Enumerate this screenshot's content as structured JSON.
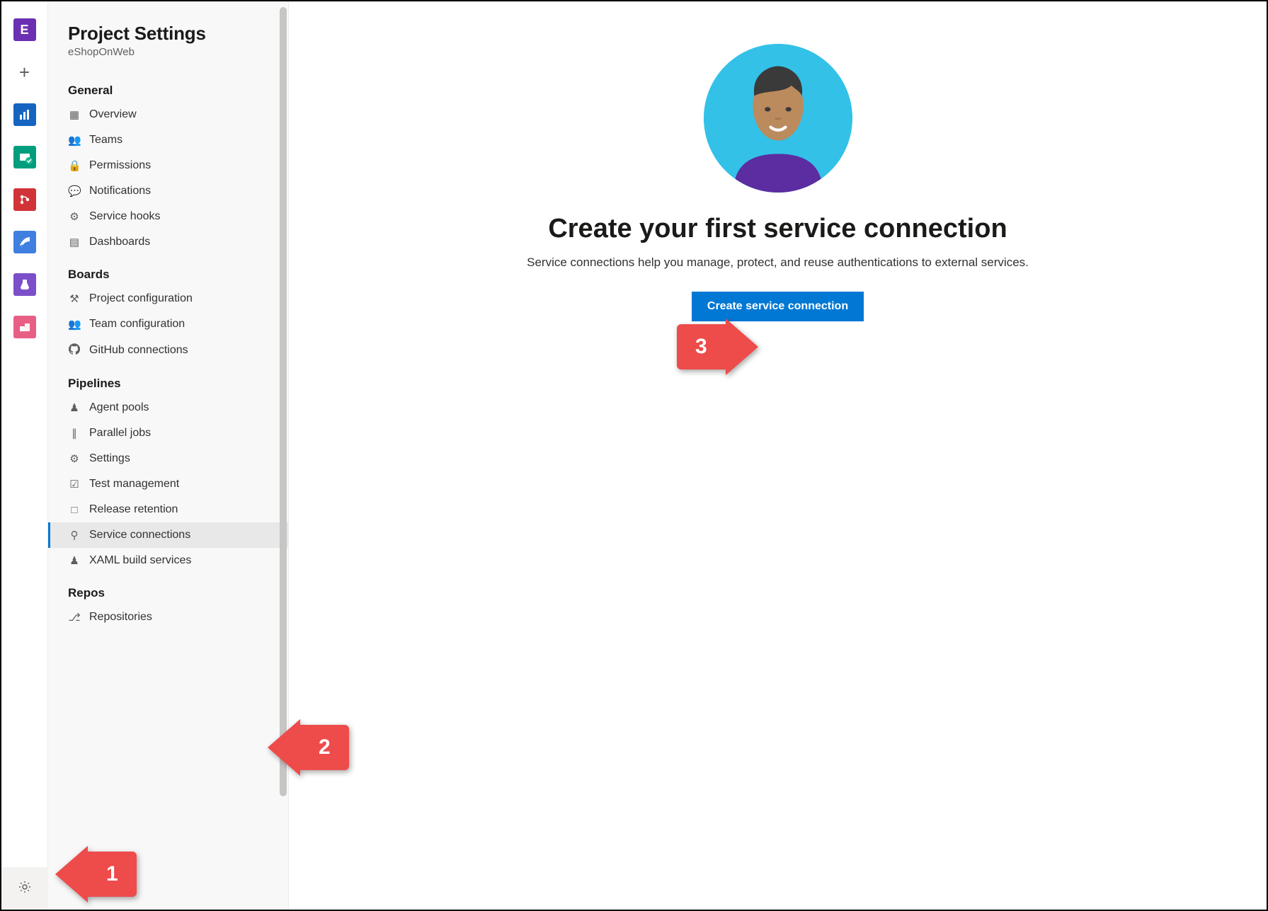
{
  "rail": {
    "project_initial": "E",
    "add_label": "+"
  },
  "settings": {
    "title": "Project Settings",
    "subtitle": "eShopOnWeb",
    "sections": [
      {
        "label": "General",
        "items": [
          {
            "icon": "overview",
            "label": "Overview"
          },
          {
            "icon": "teams",
            "label": "Teams"
          },
          {
            "icon": "permissions",
            "label": "Permissions"
          },
          {
            "icon": "notifications",
            "label": "Notifications"
          },
          {
            "icon": "service-hooks",
            "label": "Service hooks"
          },
          {
            "icon": "dashboards",
            "label": "Dashboards"
          }
        ]
      },
      {
        "label": "Boards",
        "items": [
          {
            "icon": "project-config",
            "label": "Project configuration"
          },
          {
            "icon": "team-config",
            "label": "Team configuration"
          },
          {
            "icon": "github",
            "label": "GitHub connections"
          }
        ]
      },
      {
        "label": "Pipelines",
        "items": [
          {
            "icon": "agent-pools",
            "label": "Agent pools"
          },
          {
            "icon": "parallel-jobs",
            "label": "Parallel jobs"
          },
          {
            "icon": "settings",
            "label": "Settings"
          },
          {
            "icon": "test-mgmt",
            "label": "Test management"
          },
          {
            "icon": "release-retention",
            "label": "Release retention"
          },
          {
            "icon": "service-connections",
            "label": "Service connections",
            "selected": true
          },
          {
            "icon": "xaml",
            "label": "XAML build services"
          }
        ]
      },
      {
        "label": "Repos",
        "items": [
          {
            "icon": "repositories",
            "label": "Repositories"
          }
        ]
      }
    ]
  },
  "main": {
    "title": "Create your first service connection",
    "description": "Service connections help you manage, protect, and reuse authentications to external services.",
    "button": "Create service connection"
  },
  "callouts": {
    "one": "1",
    "two": "2",
    "three": "3"
  }
}
